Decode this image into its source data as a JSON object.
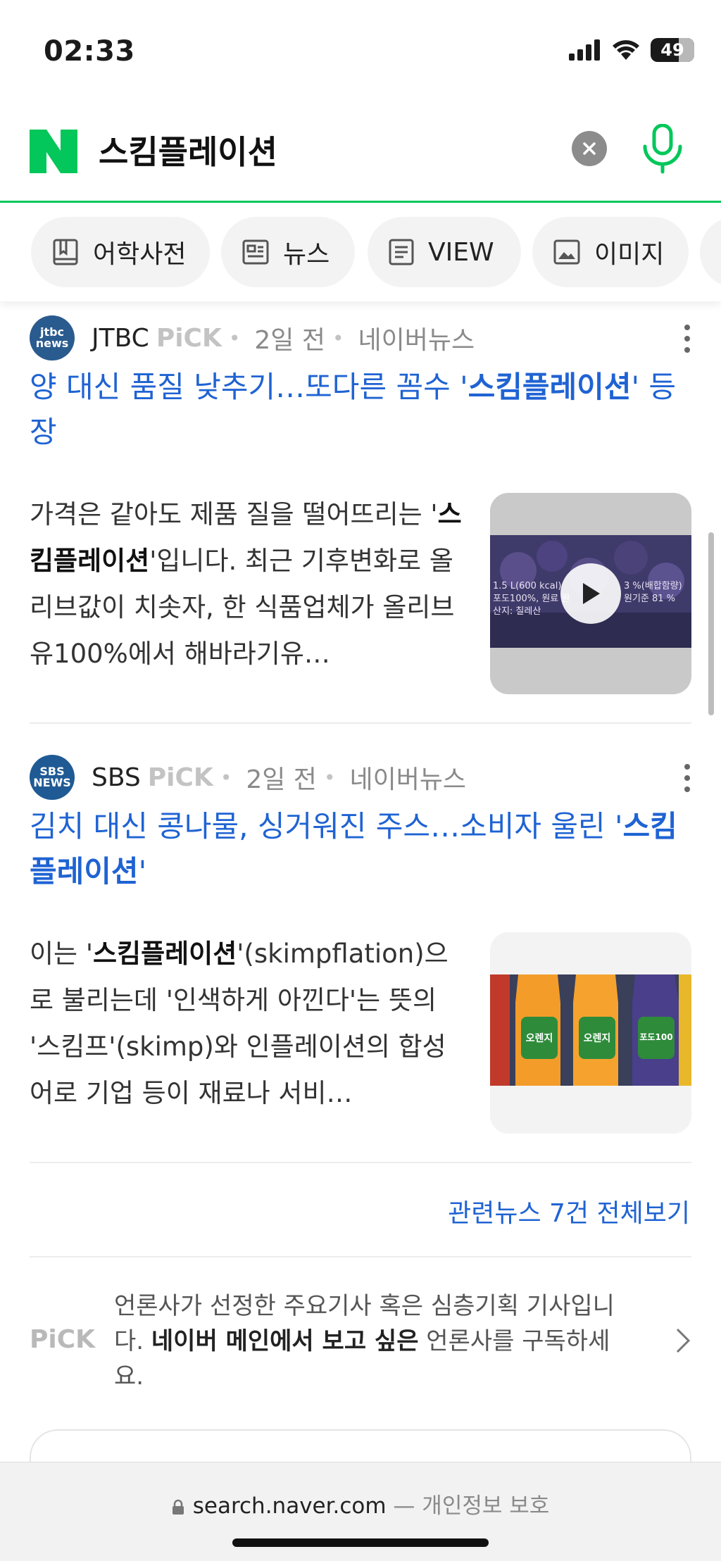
{
  "status": {
    "time": "02:33",
    "battery": "49"
  },
  "search": {
    "query": "스킴플레이션"
  },
  "tabs": [
    {
      "label": "어학사전",
      "icon": "dictionary-icon"
    },
    {
      "label": "뉴스",
      "icon": "news-icon"
    },
    {
      "label": "VIEW",
      "icon": "document-icon"
    },
    {
      "label": "이미지",
      "icon": "image-icon"
    }
  ],
  "articles": [
    {
      "press": "JTBC",
      "press_logo_top": "jtbc",
      "press_logo_bottom": "news",
      "pick": "PiCK",
      "time": "2일 전",
      "source": "네이버뉴스",
      "headline_pre": "양 대신 품질 낮추기…또다른 꼼수 '",
      "headline_bold": "스킴플레이션",
      "headline_post": "' 등장",
      "summary_pre": "가격은 같아도 제품 질을 떨어뜨리는 '",
      "summary_bold": "스킴플레이션",
      "summary_post": "'입니다. 최근 기후변화로 올리브값이 치솟자, 한 식품업체가 올리브유100%에서 해바라기유…",
      "thumb_text_1": "1.5 L(600 kcal) 포도100%, 원료 원산지: 칠레산",
      "thumb_text_2": "3 %(배합함량) 원기준 81 %"
    },
    {
      "press": "SBS",
      "press_logo_top": "SBS",
      "press_logo_bottom": "NEWS",
      "pick": "PiCK",
      "time": "2일 전",
      "source": "네이버뉴스",
      "headline_pre": "김치 대신 콩나물, 싱거워진 주스…소비자 울린 '",
      "headline_bold": "스킴플레이션",
      "headline_post": "'",
      "summary_pre": "이는 '",
      "summary_bold": "스킴플레이션",
      "summary_post": "'(skimpflation)으로 불리는데 '인색하게 아낀다'는 뜻의 '스킴프'(skimp)와 인플레이션의 합성어로 기업 등이 재료나 서비…",
      "thumb_label_1": "오렌지",
      "thumb_label_2": "오렌지",
      "thumb_label_3": "포도100"
    }
  ],
  "related_link": "관련뉴스 7건 전체보기",
  "pick_info": {
    "label": "PiCK",
    "text_pre": "언론사가 선정한 주요기사 혹은 심층기획 기사입니다. ",
    "text_bold": "네이버 메인에서 보고 싶은",
    "text_post": " 언론사를 구독하세요."
  },
  "url_bar": {
    "domain": "search.naver.com",
    "separator": " — ",
    "note": "개인정보 보호"
  },
  "colors": {
    "naver_green": "#03c75a",
    "link_blue": "#1f63d3"
  }
}
